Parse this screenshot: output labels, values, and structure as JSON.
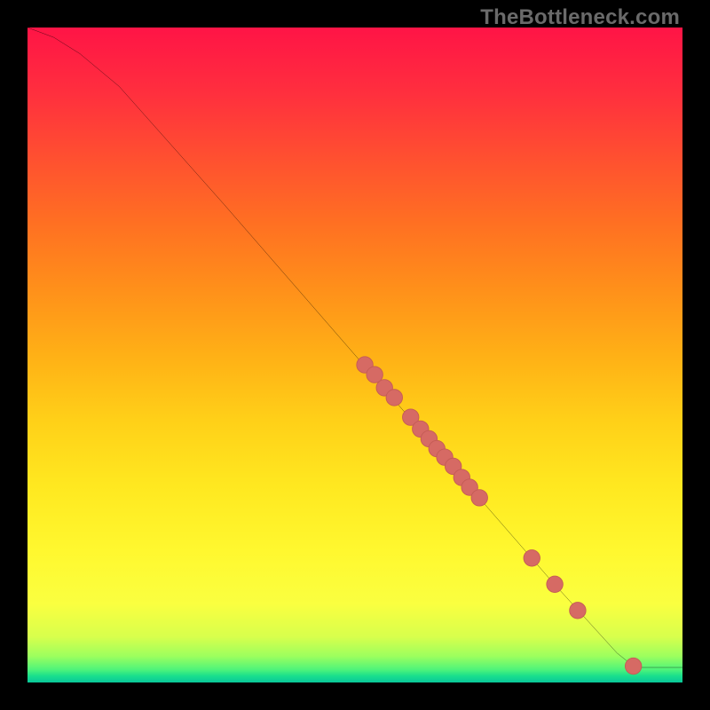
{
  "watermark": "TheBottleneck.com",
  "chart_data": {
    "type": "line",
    "title": "",
    "xlabel": "",
    "ylabel": "",
    "xlim": [
      0,
      100
    ],
    "ylim": [
      0,
      100
    ],
    "grid": false,
    "curve": [
      {
        "x": 0,
        "y": 100
      },
      {
        "x": 4,
        "y": 98.5
      },
      {
        "x": 8,
        "y": 96
      },
      {
        "x": 14,
        "y": 91
      },
      {
        "x": 22,
        "y": 82
      },
      {
        "x": 30,
        "y": 73
      },
      {
        "x": 40,
        "y": 61.5
      },
      {
        "x": 50,
        "y": 50
      },
      {
        "x": 60,
        "y": 38.5
      },
      {
        "x": 70,
        "y": 27
      },
      {
        "x": 80,
        "y": 15.5
      },
      {
        "x": 90,
        "y": 4.5
      },
      {
        "x": 92.5,
        "y": 2.5
      },
      {
        "x": 93.5,
        "y": 2.3
      },
      {
        "x": 100,
        "y": 2.3
      }
    ],
    "points": [
      {
        "x": 51.5,
        "y": 48.5
      },
      {
        "x": 53.0,
        "y": 47.0
      },
      {
        "x": 54.5,
        "y": 45.0
      },
      {
        "x": 56.0,
        "y": 43.5
      },
      {
        "x": 58.5,
        "y": 40.5
      },
      {
        "x": 60.0,
        "y": 38.7
      },
      {
        "x": 61.3,
        "y": 37.2
      },
      {
        "x": 62.5,
        "y": 35.7
      },
      {
        "x": 63.7,
        "y": 34.4
      },
      {
        "x": 65.0,
        "y": 33.0
      },
      {
        "x": 66.3,
        "y": 31.3
      },
      {
        "x": 67.5,
        "y": 29.8
      },
      {
        "x": 69.0,
        "y": 28.2
      },
      {
        "x": 77.0,
        "y": 19.0
      },
      {
        "x": 80.5,
        "y": 15.0
      },
      {
        "x": 84.0,
        "y": 11.0
      },
      {
        "x": 92.5,
        "y": 2.5
      }
    ],
    "colors": {
      "curve_stroke": "#000000",
      "point_fill": "#d66a64",
      "point_stroke": "#c45b55"
    }
  }
}
